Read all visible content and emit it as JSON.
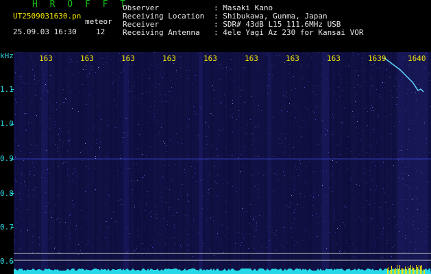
{
  "header": {
    "app_title": "H R O F F T",
    "file_name": "UT2509031630.pn",
    "mode_label": "meteor",
    "datetime": "25.09.03 16:30",
    "count": "12",
    "info": [
      {
        "label": "Observer",
        "value": ": Masaki Kano"
      },
      {
        "label": "Receiving Location",
        "value": ": Shibukawa, Gunma, Japan"
      },
      {
        "label": "Receiver",
        "value": ": SDR# 43dB L15 111.6MHz USB"
      },
      {
        "label": "Receiving Antenna",
        "value": ": 4ele Yagi Az 230 for Kansai VOR"
      }
    ]
  },
  "axis": {
    "unit": "kHz",
    "freq_labels": [
      "1.1",
      "1.0",
      "0.9",
      "0.8",
      "0.7",
      "0.6"
    ],
    "time_labels": [
      "163",
      "163",
      "163",
      "163",
      "163",
      "163",
      "163",
      "163",
      "1639",
      "1640"
    ]
  },
  "colors": {
    "background": "#000000",
    "spectrogram": "#0d0d3a",
    "title_green": "#17c317",
    "label_yellow": "#f3e600",
    "axis_cyan": "#27d9e8",
    "text_white": "#e8e8e8"
  }
}
